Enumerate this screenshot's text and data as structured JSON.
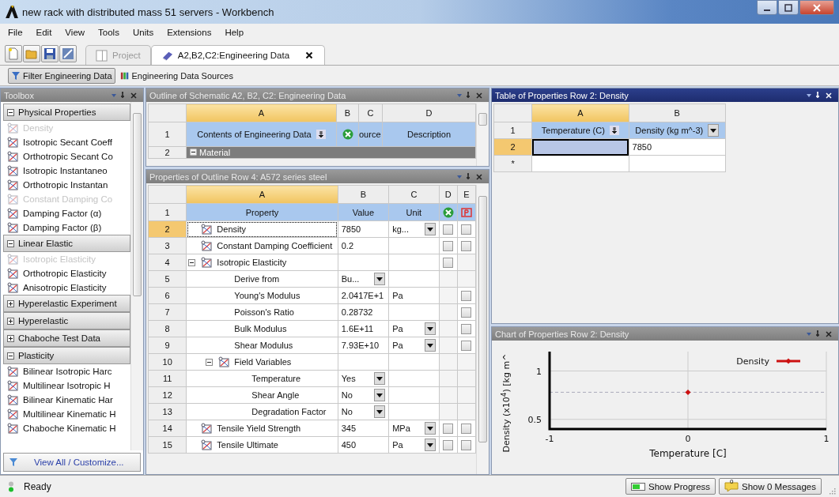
{
  "window": {
    "title": "new rack with distributed mass 51 servers - Workbench"
  },
  "menu": [
    "File",
    "Edit",
    "View",
    "Tools",
    "Units",
    "Extensions",
    "Help"
  ],
  "tabs": [
    {
      "label": "Project",
      "selected": false,
      "closable": false
    },
    {
      "label": "A2,B2,C2:Engineering Data",
      "selected": true,
      "closable": true
    }
  ],
  "filter_bar": [
    {
      "label": "Filter Engineering Data",
      "selected": true
    },
    {
      "label": "Engineering Data Sources",
      "selected": false
    }
  ],
  "toolbox": {
    "title": "Toolbox",
    "sections": [
      {
        "label": "Physical Properties",
        "expanded": true,
        "items": [
          {
            "label": "Density",
            "disabled": true
          },
          {
            "label": "Isotropic Secant Coeff",
            "disabled": false
          },
          {
            "label": "Orthotropic Secant Co",
            "disabled": false
          },
          {
            "label": "Isotropic Instantaneo",
            "disabled": false
          },
          {
            "label": "Orthotropic Instantan",
            "disabled": false
          },
          {
            "label": "Constant Damping Co",
            "disabled": true
          },
          {
            "label": "Damping Factor (α)",
            "disabled": false
          },
          {
            "label": "Damping Factor (β)",
            "disabled": false
          }
        ]
      },
      {
        "label": "Linear Elastic",
        "expanded": true,
        "items": [
          {
            "label": "Isotropic Elasticity",
            "disabled": true
          },
          {
            "label": "Orthotropic Elasticity",
            "disabled": false
          },
          {
            "label": "Anisotropic Elasticity",
            "disabled": false
          }
        ]
      },
      {
        "label": "Hyperelastic Experiment",
        "expanded": false
      },
      {
        "label": "Hyperelastic",
        "expanded": false
      },
      {
        "label": "Chaboche Test Data",
        "expanded": false
      },
      {
        "label": "Plasticity",
        "expanded": true,
        "items": [
          {
            "label": "Bilinear Isotropic Harc",
            "disabled": false
          },
          {
            "label": "Multilinear Isotropic H",
            "disabled": false
          },
          {
            "label": "Bilinear Kinematic Har",
            "disabled": false
          },
          {
            "label": "Multilinear Kinematic H",
            "disabled": false
          },
          {
            "label": "Chaboche Kinematic H",
            "disabled": false
          }
        ]
      }
    ],
    "footer": "View All / Customize..."
  },
  "outline": {
    "title": "Outline of Schematic A2, B2, C2: Engineering Data",
    "columns": [
      "A",
      "B",
      "C",
      "D"
    ],
    "rows": [
      {
        "num": "1",
        "kind": "header",
        "cells": [
          "Contents of Engineering Data",
          "",
          "ource",
          "Description"
        ]
      },
      {
        "num": "2",
        "kind": "group",
        "cells": [
          {
            "text": "Material",
            "colspan": 4
          }
        ]
      }
    ]
  },
  "properties": {
    "title": "Properties of Outline Row 4: A572 series steel",
    "columns": [
      "A",
      "B",
      "C",
      "D",
      "E"
    ],
    "header": {
      "num": "1",
      "cells": [
        "Property",
        "Value",
        "Unit"
      ]
    },
    "rows": [
      {
        "num": "2",
        "property": "Density",
        "icon": true,
        "value": "7850",
        "unit": "kg...",
        "unit_dropdown": true,
        "d_checked": false,
        "e_checked": false,
        "selected": true
      },
      {
        "num": "3",
        "property": "Constant Damping Coefficient",
        "icon": true,
        "value": "0.2",
        "d_checked": false,
        "e_checked": false,
        "selected": false
      },
      {
        "num": "4",
        "property": "Isotropic Elasticity",
        "icon": true,
        "expanded": true,
        "d_checked": false,
        "selected": false,
        "children": [
          {
            "num": "5",
            "property": "Derive from",
            "value": "Bu...",
            "value_dropdown": true,
            "selected": false
          },
          {
            "num": "6",
            "property": "Young's Modulus",
            "value": "2.0417E+1",
            "unit": "Pa",
            "e_checked": false,
            "selected": false
          },
          {
            "num": "7",
            "property": "Poisson's Ratio",
            "value": "0.28732",
            "e_checked": false,
            "selected": false
          },
          {
            "num": "8",
            "property": "Bulk Modulus",
            "value": "1.6E+11",
            "unit": "Pa",
            "unit_dropdown": true,
            "e_checked": false,
            "selected": false
          },
          {
            "num": "9",
            "property": "Shear Modulus",
            "value": "7.93E+10",
            "unit": "Pa",
            "unit_dropdown": true,
            "e_checked": false,
            "selected": false
          },
          {
            "num": "10",
            "property": "Field Variables",
            "icon": true,
            "expanded": true,
            "selected": false,
            "children": [
              {
                "num": "11",
                "property": "Temperature",
                "value": "Yes",
                "value_dropdown": true,
                "selected": false
              },
              {
                "num": "12",
                "property": "Shear Angle",
                "value": "No",
                "value_dropdown": true,
                "selected": false
              },
              {
                "num": "13",
                "property": "Degradation Factor",
                "value": "No",
                "value_dropdown": true,
                "selected": false
              }
            ]
          }
        ]
      },
      {
        "num": "14",
        "property": "Tensile Yield Strength",
        "icon": true,
        "value": "345",
        "unit": "MPa",
        "unit_dropdown": true,
        "d_checked": false,
        "e_checked": false,
        "selected": false
      },
      {
        "num": "15",
        "property": "Tensile Ultimate",
        "icon": true,
        "value": "450",
        "unit": "Pa",
        "unit_dropdown": true,
        "d_checked": false,
        "e_checked": false,
        "selected": false
      }
    ]
  },
  "table": {
    "title": "Table of Properties Row 2: Density",
    "columns": [
      "A",
      "B"
    ],
    "header": {
      "num": "1",
      "cells": [
        "Temperature (C)",
        "Density (kg m^-3)"
      ]
    },
    "rows": [
      {
        "num": "2",
        "b": "7850",
        "selected": true
      },
      {
        "num": "*",
        "selected": false
      }
    ]
  },
  "chart": {
    "title": "Chart of Properties Row 2: Density",
    "chart_data": {
      "type": "line",
      "xlabel": "Temperature [C]",
      "ylabel": "Density  (x10$^{4}$)  [kg m^",
      "x": [
        0
      ],
      "series": [
        {
          "name": "Density",
          "color": "#cc1111",
          "marker": "diamond",
          "values": [
            0.78
          ]
        }
      ],
      "xlim": [
        -1,
        1
      ],
      "ylim": [
        0.4,
        1.2
      ],
      "xticks": [
        -1,
        0,
        1
      ],
      "yticks": [
        0.5,
        1
      ],
      "grid": true,
      "ref_lines": [
        {
          "axis": "y",
          "value": 0.78
        }
      ]
    }
  },
  "status_bar": {
    "text": "Ready",
    "buttons": [
      {
        "label": "Show Progress",
        "kind": "progress"
      },
      {
        "label": "Show 0 Messages",
        "kind": "messages",
        "badge": "0"
      }
    ]
  }
}
